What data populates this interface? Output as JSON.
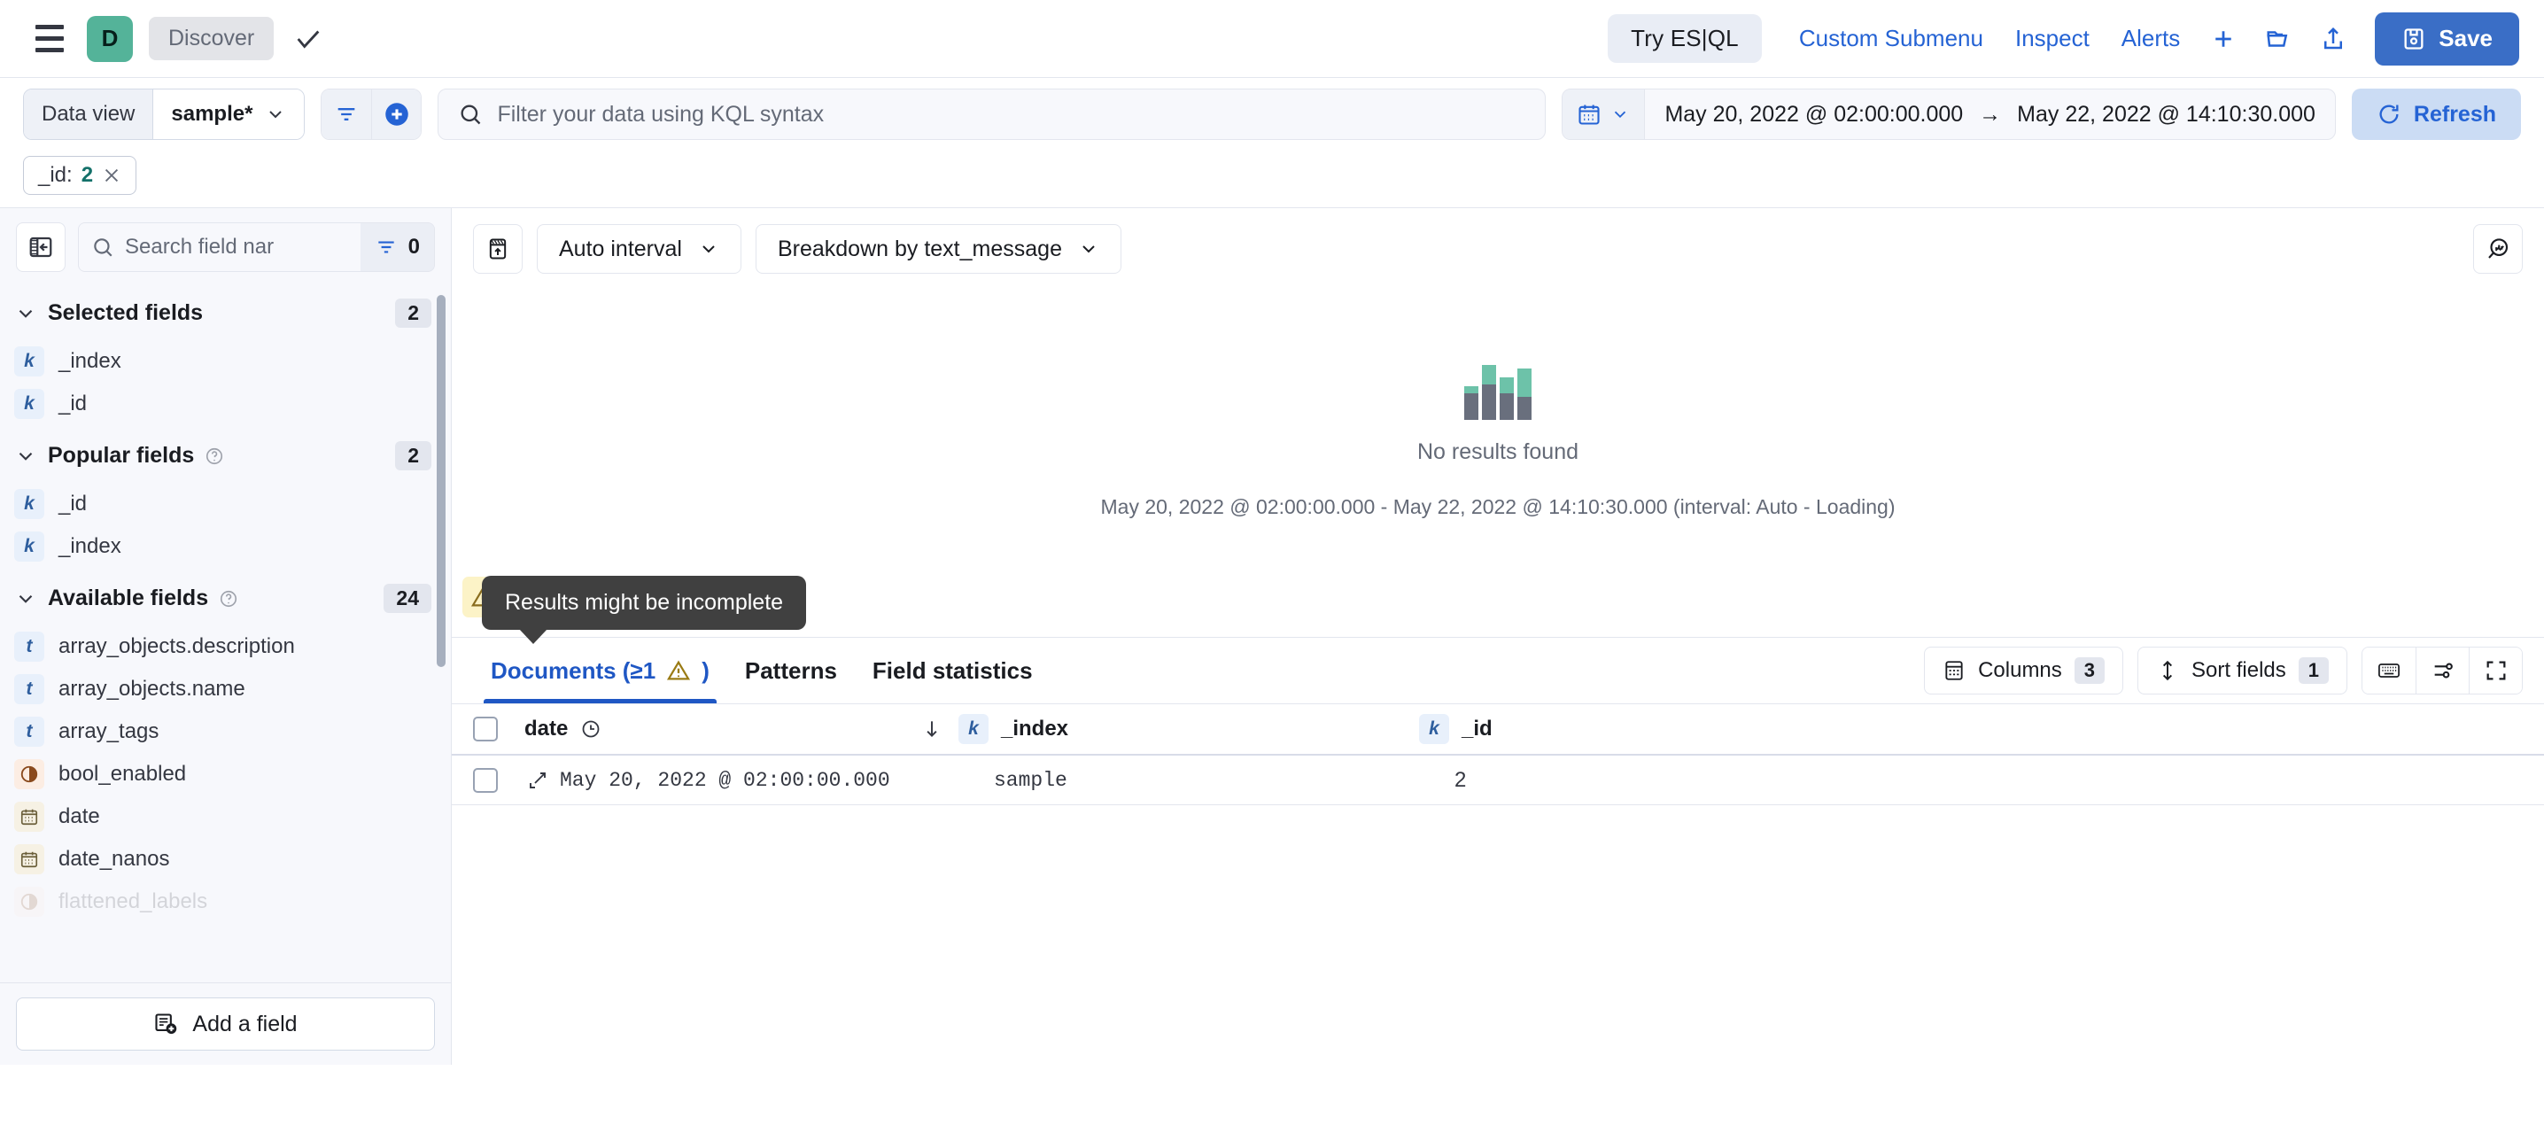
{
  "topnav": {
    "menu_icon": "hamburger-icon",
    "app_initial": "D",
    "breadcrumb": "Discover",
    "check_icon": "check-icon",
    "esql_label": "Try ES|QL",
    "links": [
      {
        "label": "Custom Submenu"
      },
      {
        "label": "Inspect"
      },
      {
        "label": "Alerts"
      }
    ],
    "plus_icon": "plus-icon",
    "folder_icon": "folder-open-icon",
    "share_icon": "share-icon",
    "save_label": "Save",
    "save_color": "#3A6EC6",
    "accent_color": "#2563D4"
  },
  "querybar": {
    "dataview_label": "Data view",
    "dataview_value": "sample*",
    "filter_icon": "filter-icon",
    "add_filter_icon": "add-filter-icon",
    "search_placeholder": "Filter your data using KQL syntax",
    "search_value": "",
    "calendar_icon": "calendar-icon",
    "date_start": "May 20, 2022 @ 02:00:00.000",
    "date_arrow": "→",
    "date_end": "May 22, 2022 @ 14:10:30.000",
    "refresh_label": "Refresh"
  },
  "filters": [
    {
      "field": "_id:",
      "value": "2",
      "remove_icon": "close-icon"
    }
  ],
  "sidebar": {
    "collapse_icon": "collapse-sidebar-icon",
    "search_placeholder": "Search field nar",
    "search_value": "",
    "field_filter_icon": "field-filter-icon",
    "field_filter_count": "0",
    "groups": [
      {
        "title": "Selected fields",
        "count": "2",
        "has_help": false,
        "fields": [
          {
            "name": "_index",
            "type": "k"
          },
          {
            "name": "_id",
            "type": "k"
          }
        ]
      },
      {
        "title": "Popular fields",
        "count": "2",
        "has_help": true,
        "fields": [
          {
            "name": "_id",
            "type": "k"
          },
          {
            "name": "_index",
            "type": "k"
          }
        ]
      },
      {
        "title": "Available fields",
        "count": "24",
        "has_help": true,
        "fields": [
          {
            "name": "array_objects.description",
            "type": "t"
          },
          {
            "name": "array_objects.name",
            "type": "t"
          },
          {
            "name": "array_tags",
            "type": "t"
          },
          {
            "name": "bool_enabled",
            "type": "b"
          },
          {
            "name": "date",
            "type": "d"
          },
          {
            "name": "date_nanos",
            "type": "d"
          },
          {
            "name": "flattened_labels",
            "type": "b"
          }
        ]
      }
    ],
    "add_field_label": "Add a field",
    "add_field_icon": "add-field-icon"
  },
  "chart": {
    "toggle_icon": "chart-toggle-icon",
    "interval_label": "Auto interval",
    "breakdown_label": "Breakdown by text_message",
    "options_icon": "chart-options-icon",
    "empty_title": "No results found",
    "empty_icon": "bar-chart-icon",
    "time_caption": "May 20, 2022 @ 02:00:00.000 - May 22, 2022 @ 14:10:30.000 (interval: Auto - Loading)",
    "warning_icon": "warning-icon",
    "tooltip_text": "Results might be incomplete"
  },
  "tabs": [
    {
      "label": "Documents (≥1",
      "suffix": ")",
      "warning_icon": "warning-icon",
      "active": true
    },
    {
      "label": "Patterns",
      "active": false
    },
    {
      "label": "Field statistics",
      "active": false
    }
  ],
  "grid_toolbar": {
    "columns_icon": "columns-icon",
    "columns_label": "Columns",
    "columns_count": "3",
    "sort_icon": "sort-icon",
    "sort_label": "Sort fields",
    "sort_count": "1",
    "keyboard_icon": "keyboard-icon",
    "display_options_icon": "display-options-icon",
    "fullscreen_icon": "fullscreen-icon"
  },
  "grid": {
    "select_all_icon": "checkbox-unchecked",
    "columns": [
      {
        "label": "date",
        "icon": "clock-icon",
        "sort_icon": "sort-desc-arrow"
      },
      {
        "label": "_index",
        "type_badge": "k"
      },
      {
        "label": "_id",
        "type_badge": "k"
      }
    ],
    "rows": [
      {
        "checkbox": "checkbox-unchecked",
        "expand_icon": "expand-row-icon",
        "date": "May 20, 2022 @ 02:00:00.000",
        "_index": "sample",
        "_id": "2"
      }
    ]
  },
  "colors": {
    "brand_green": "#54B399",
    "link_blue": "#2563D4",
    "save_blue": "#3A6EC6",
    "filter_value_teal": "#14716A",
    "warning_yellow": "#FCF3C7",
    "tooltip_bg": "#404040"
  }
}
